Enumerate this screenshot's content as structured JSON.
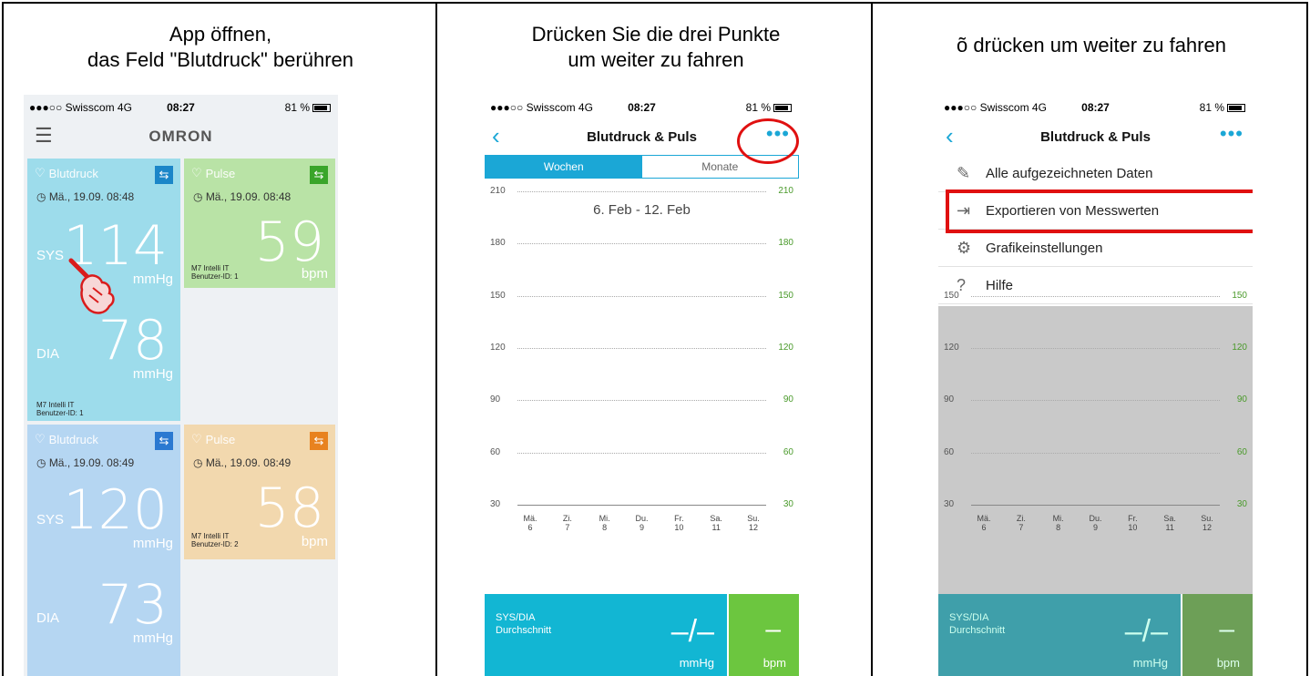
{
  "captions": {
    "step1_line1": "App öffnen,",
    "step1_line2": "das Feld \"Blutdruck\" berühren",
    "step2_line1": "Drücken Sie die drei Punkte",
    "step2_line2": "um weiter zu fahren",
    "step3_line1": "õ  drücken um weiter zu fahren"
  },
  "status": {
    "carrier": "●●●○○ Swisscom  4G",
    "time": "08:27",
    "battery": "81 %"
  },
  "app1": {
    "brand": "OMRON",
    "tiles": [
      {
        "title": "Blutdruck",
        "date": "Mä., 19.09. 08:48",
        "sys": "114",
        "dia": "78",
        "sys_label": "SYS",
        "dia_label": "DIA",
        "unit": "mmHg",
        "device1": "M7 Intelli IT",
        "device2": "Benutzer-ID: 1"
      },
      {
        "title": "Pulse",
        "date": "Mä., 19.09. 08:48",
        "value": "59",
        "unit": "bpm",
        "device1": "M7 Intelli IT",
        "device2": "Benutzer-ID: 1"
      },
      {
        "title": "Blutdruck",
        "date": "Mä., 19.09. 08:49",
        "sys": "120",
        "dia": "73",
        "sys_label": "SYS",
        "dia_label": "DIA",
        "unit": "mmHg"
      },
      {
        "title": "Pulse",
        "date": "Mä., 19.09. 08:49",
        "value": "58",
        "unit": "bpm",
        "device1": "M7 Intelli IT",
        "device2": "Benutzer-ID: 2"
      }
    ]
  },
  "app2": {
    "title": "Blutdruck & Puls",
    "tabs": [
      "Wochen",
      "Monate"
    ],
    "range": "6. Feb - 12. Feb",
    "summary": {
      "label1": "SYS/DIA",
      "label2": "Durchschnitt",
      "value": "–/–",
      "unit": "mmHg",
      "pulse_value": "–",
      "pulse_unit": "bpm"
    }
  },
  "app3": {
    "title": "Blutdruck & Puls",
    "menu": [
      "Alle aufgezeichneten Daten",
      "Exportieren von Messwerten",
      "Grafikeinstellungen",
      "Hilfe"
    ]
  },
  "chart_data": {
    "type": "line",
    "y_ticks": [
      210,
      180,
      150,
      120,
      90,
      60,
      30
    ],
    "x_labels": [
      [
        "Mä.",
        "6"
      ],
      [
        "Zi.",
        "7"
      ],
      [
        "Mi.",
        "8"
      ],
      [
        "Du.",
        "9"
      ],
      [
        "Fr.",
        "10"
      ],
      [
        "Sa.",
        "11"
      ],
      [
        "Su.",
        "12"
      ]
    ],
    "ylim": [
      30,
      210
    ],
    "series": []
  },
  "colors": {
    "accent": "#1ba7d6",
    "bp_tile": "#9ddceb",
    "pulse_tile": "#b9e3a6",
    "bp_tile2": "#b5d6f2",
    "pulse_tile2": "#f2d8ae",
    "summary_bp": "#12b6d3",
    "summary_pulse": "#6cc63f",
    "highlight": "#e01010"
  }
}
